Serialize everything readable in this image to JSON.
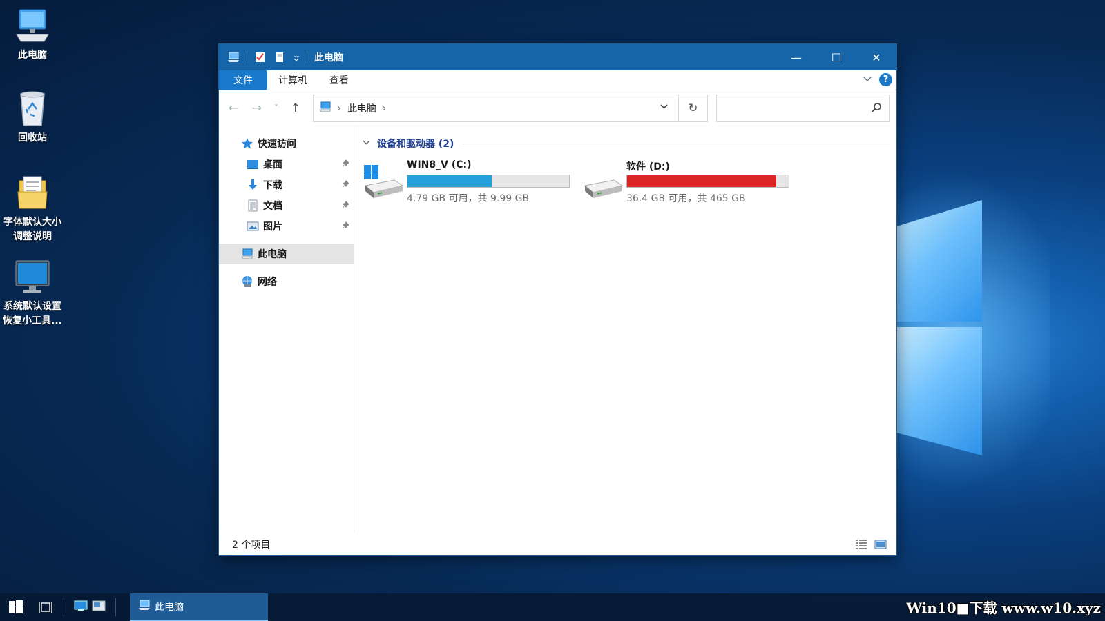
{
  "desktop": {
    "icons": [
      {
        "label": "此电脑",
        "icon": "computer-icon"
      },
      {
        "label": "回收站",
        "icon": "recycle-bin-icon"
      },
      {
        "label_line1": "字体默认大小",
        "label_line2": "调整说明",
        "icon": "document-folder-icon"
      },
      {
        "label_line1": "系统默认设置",
        "label_line2": "恢复小工具...",
        "icon": "monitor-icon"
      }
    ]
  },
  "window": {
    "title": "此电脑",
    "controls": {
      "minimize": "—",
      "maximize": "☐",
      "close": "✕"
    }
  },
  "ribbon": {
    "tabs": [
      {
        "label": "文件",
        "active": true
      },
      {
        "label": "计算机"
      },
      {
        "label": "查看"
      }
    ],
    "help": "?"
  },
  "navigation": {
    "back": "←",
    "forward": "→",
    "recent": "˅",
    "up": "↑",
    "breadcrumb": [
      "此电脑"
    ],
    "refresh": "↻",
    "search_placeholder": ""
  },
  "sidebar": {
    "quick_access": {
      "label": "快速访问"
    },
    "pinned": [
      {
        "label": "桌面",
        "icon": "desktop-folder-icon"
      },
      {
        "label": "下载",
        "icon": "download-icon"
      },
      {
        "label": "文档",
        "icon": "documents-icon"
      },
      {
        "label": "图片",
        "icon": "pictures-icon"
      }
    ],
    "this_pc": {
      "label": "此电脑"
    },
    "network": {
      "label": "网络"
    }
  },
  "main": {
    "group_title": "设备和驱动器 (2)",
    "drives": [
      {
        "name": "WIN8_V (C:)",
        "size_text": "4.79 GB 可用，共 9.99 GB",
        "free_gb": 4.79,
        "total_gb": 9.99,
        "bar_color": "#26a0da",
        "system": true
      },
      {
        "name": "软件 (D:)",
        "size_text": "36.4 GB 可用，共 465 GB",
        "free_gb": 36.4,
        "total_gb": 465,
        "bar_color": "#da2626",
        "system": false
      }
    ]
  },
  "status": {
    "items": "2 个项目"
  },
  "taskbar": {
    "active_app": "此电脑"
  },
  "watermark": "Win10■下载 www.w10.xyz"
}
